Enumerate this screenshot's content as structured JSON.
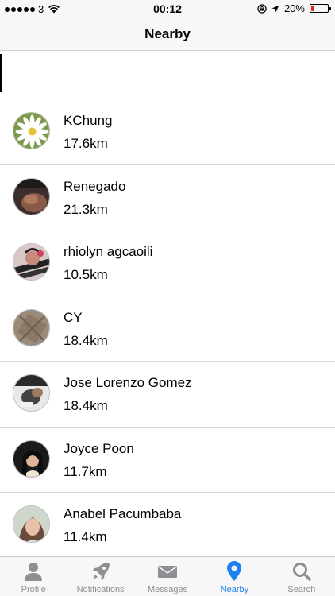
{
  "status_bar": {
    "carrier": "3",
    "time": "00:12",
    "battery": "20%",
    "battery_fraction": 0.2
  },
  "nav": {
    "title": "Nearby"
  },
  "users": [
    {
      "name": "KChung",
      "distance": "17.6km"
    },
    {
      "name": "Renegado",
      "distance": "21.3km"
    },
    {
      "name": "rhiolyn agcaoili",
      "distance": "10.5km"
    },
    {
      "name": "CY",
      "distance": "18.4km"
    },
    {
      "name": "Jose Lorenzo Gomez",
      "distance": "18.4km"
    },
    {
      "name": "Joyce Poon",
      "distance": "11.7km"
    },
    {
      "name": "Anabel Pacumbaba",
      "distance": "11.4km"
    }
  ],
  "tabs": [
    {
      "label": "Profile",
      "icon": "person-icon"
    },
    {
      "label": "Notifications",
      "icon": "rocket-icon"
    },
    {
      "label": "Messages",
      "icon": "envelope-icon"
    },
    {
      "label": "Nearby",
      "icon": "location-pin-icon",
      "active": true
    },
    {
      "label": "Search",
      "icon": "magnifier-icon"
    }
  ],
  "colors": {
    "accent": "#1d80f0",
    "inactive": "#8e8e93",
    "battery_low": "#e02424"
  }
}
